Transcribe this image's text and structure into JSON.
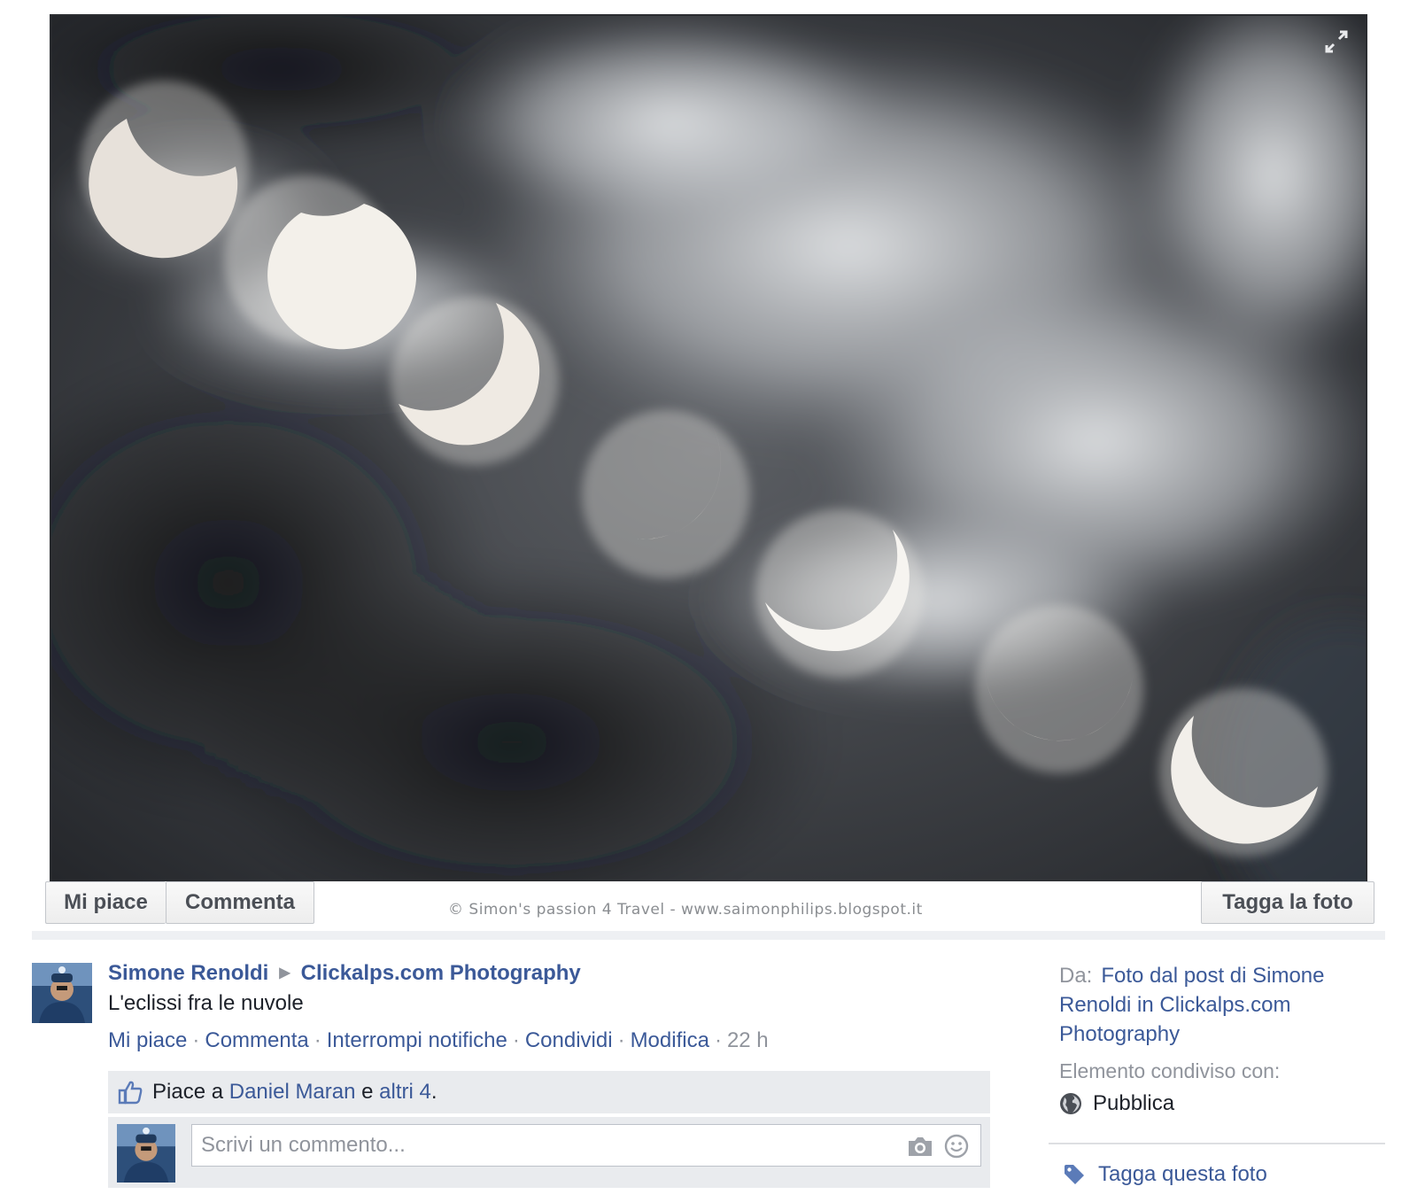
{
  "photo": {
    "watermark": "© Simon's passion 4 Travel  - www.saimonphilips.blogspot.it",
    "actions": {
      "like": "Mi piace",
      "comment": "Commenta",
      "tag": "Tagga la foto"
    },
    "icons": {
      "expand": "expand-icon"
    }
  },
  "post": {
    "author": "Simone Renoldi",
    "target_page": "Clickalps.com Photography",
    "text": "L'eclissi fra le nuvole",
    "actions": [
      "Mi piace",
      "Commenta",
      "Interrompi notifiche",
      "Condividi",
      "Modifica"
    ],
    "time": "22 h",
    "likes": {
      "prefix": "Piace a",
      "person": "Daniel Maran",
      "conjunction": "e",
      "others": "altri 4",
      "suffix": "."
    },
    "comment_placeholder": "Scrivi un commento..."
  },
  "sidebar": {
    "from_label": "Da:",
    "from_link": "Foto dal post di Simone Renoldi in Clickalps.com Photography",
    "shared_with_label": "Elemento condiviso con:",
    "audience": "Pubblica",
    "tag_link": "Tagga questa foto"
  },
  "colors": {
    "link": "#3b5998",
    "muted": "#90949c",
    "bar_bg": "#e9ebee"
  }
}
